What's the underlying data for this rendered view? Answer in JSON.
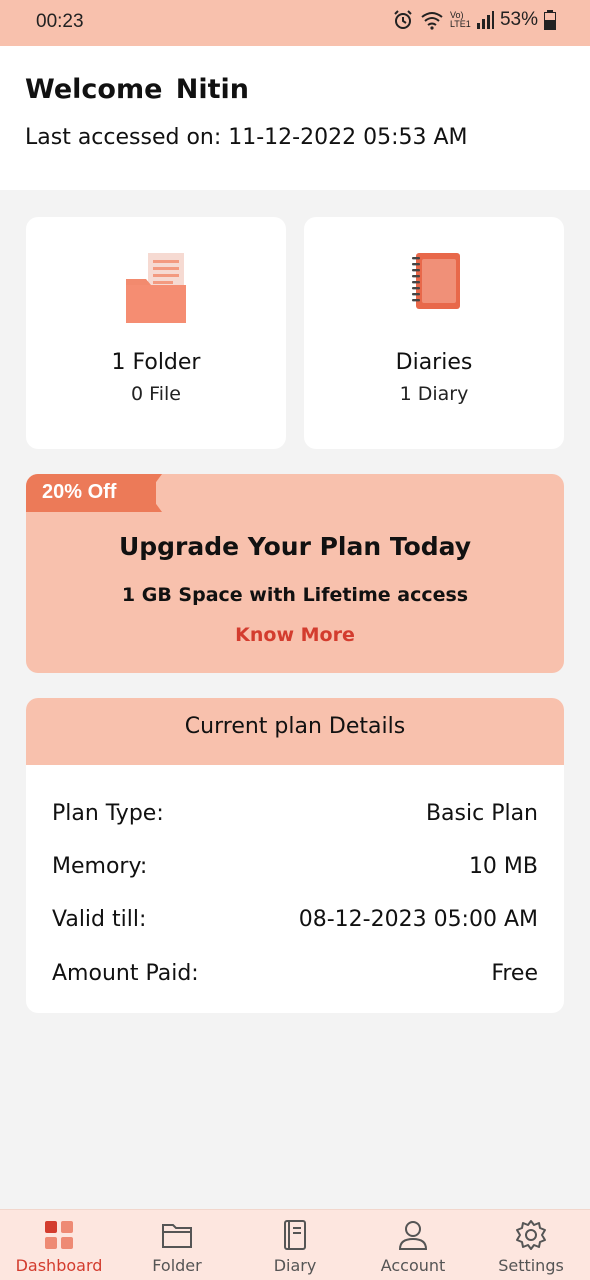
{
  "status_bar": {
    "time": "00:23",
    "battery": "53%",
    "network_label": "Vo) LTE1"
  },
  "welcome": {
    "title": "Welcome  Nitin",
    "last_accessed": "Last accessed on: 11-12-2022 05:53 AM"
  },
  "cards": {
    "folder": {
      "title": "1 Folder",
      "subtitle": "0 File",
      "icon": "folder-icon"
    },
    "diary": {
      "title": "Diaries",
      "subtitle": "1  Diary",
      "icon": "notebook-icon"
    }
  },
  "promo": {
    "ribbon": "20% Off",
    "title": "Upgrade Your Plan Today",
    "subtitle": "1 GB Space with Lifetime access",
    "link": "Know More"
  },
  "plan": {
    "header": "Current plan Details",
    "rows": [
      {
        "label": "Plan Type:",
        "value": "Basic Plan"
      },
      {
        "label": "Memory:",
        "value": "10 MB"
      },
      {
        "label": "Valid till:",
        "value": "08-12-2023 05:00 AM"
      },
      {
        "label": "Amount Paid:",
        "value": "Free"
      }
    ]
  },
  "nav": {
    "items": [
      {
        "label": "Dashboard",
        "icon": "dashboard-icon",
        "active": true
      },
      {
        "label": "Folder",
        "icon": "folder-outline-icon",
        "active": false
      },
      {
        "label": "Diary",
        "icon": "diary-outline-icon",
        "active": false
      },
      {
        "label": "Account",
        "icon": "account-icon",
        "active": false
      },
      {
        "label": "Settings",
        "icon": "gear-icon",
        "active": false
      }
    ]
  },
  "colors": {
    "accent": "#f8c1ad",
    "ribbon": "#ec7a58",
    "link": "#d33c2e",
    "nav_bg": "#fde6df"
  }
}
